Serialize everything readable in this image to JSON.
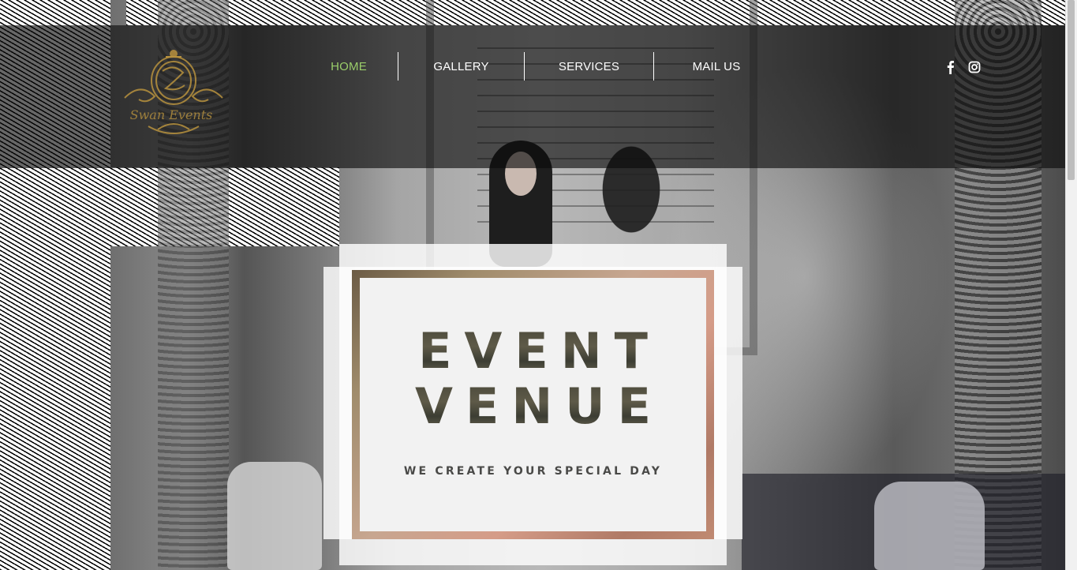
{
  "brand": {
    "logo_text": "Swan Events"
  },
  "nav": {
    "items": [
      {
        "label": "HOME",
        "active": true
      },
      {
        "label": "GALLERY",
        "active": false
      },
      {
        "label": "SERVICES",
        "active": false
      },
      {
        "label": "MAIL US",
        "active": false
      }
    ],
    "active_color": "#9acd6a"
  },
  "social": {
    "icons": [
      "facebook-icon",
      "instagram-icon"
    ]
  },
  "hero": {
    "title_line1": "EVENT",
    "title_line2": "VENUE",
    "tagline": "WE CREATE YOUR SPECIAL DAY"
  },
  "colors": {
    "header_overlay": "rgba(10,10,10,0.62)",
    "logo_gold": "#b8923e"
  }
}
